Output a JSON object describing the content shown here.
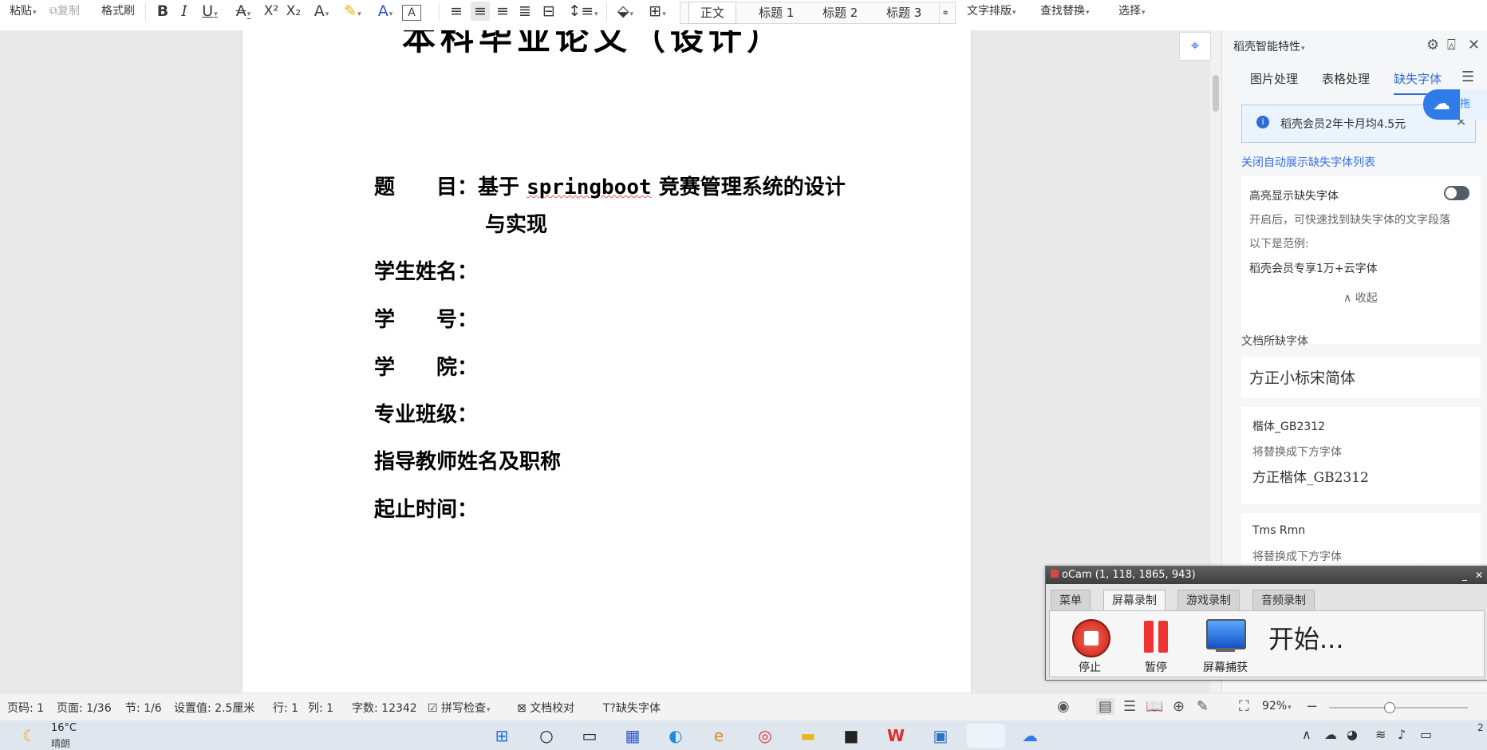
{
  "ribbon": {
    "paste": "粘贴",
    "copy": "复制",
    "format_painter": "格式刷",
    "styles": [
      "正文",
      "标题 1",
      "标题 2",
      "标题 3"
    ],
    "text_layout": "文字排版",
    "find_replace": "查找替换",
    "select": "选择"
  },
  "document": {
    "title": "本科毕业论文（设计）",
    "topic_label": "题　　目：",
    "topic_prefix": "基于",
    "topic_keyword": "springboot",
    "topic_suffix": "竞赛管理系统的设计",
    "topic_line2": "与实现",
    "fields": [
      "学生姓名：",
      "学　　号：",
      "学　　院：",
      "专业班级：",
      "指导教师姓名及职称",
      "起止时间："
    ]
  },
  "panel": {
    "header": "稻壳智能特性",
    "tabs": [
      "图片处理",
      "表格处理",
      "缺失字体"
    ],
    "banner_text": "稻壳会员2年卡月均4.5元",
    "close_auto_link": "关闭自动展示缺失字体列表",
    "highlight_title": "高亮显示缺失字体",
    "highlight_desc": "开启后，可快速找到缺失字体的文字段落",
    "example_label": "以下是范例:",
    "example_text": "稻壳会员专享1万+云字体",
    "collapse": "收起",
    "missing_title": "文档所缺字体",
    "missing_fonts": [
      {
        "name": "方正小标宋简体"
      },
      {
        "name": "楷体_GB2312",
        "replace_label": "将替换成下方字体",
        "replacement": "方正楷体_GB2312"
      },
      {
        "name": "Tms Rmn",
        "replace_label": "将替换成下方字体"
      }
    ],
    "side_tag": "拖"
  },
  "ocam": {
    "title": "oCam (1, 118, 1865, 943)",
    "tabs": [
      "菜单",
      "屏幕录制",
      "游戏录制",
      "音频录制"
    ],
    "stop": "停止",
    "pause": "暂停",
    "capture": "屏幕捕获",
    "start_text": "开始..."
  },
  "status": {
    "page_no": "页码: 1",
    "page": "页面: 1/36",
    "section": "节: 1/6",
    "setting": "设置值: 2.5厘米",
    "row": "行: 1",
    "col": "列: 1",
    "words": "字数: 12342",
    "spell": "拼写检查",
    "proof": "文档校对",
    "missing_font": "缺失字体",
    "zoom": "92%"
  },
  "taskbar": {
    "temp": "16°C",
    "weather": "晴朗",
    "clock_partial": "2"
  }
}
